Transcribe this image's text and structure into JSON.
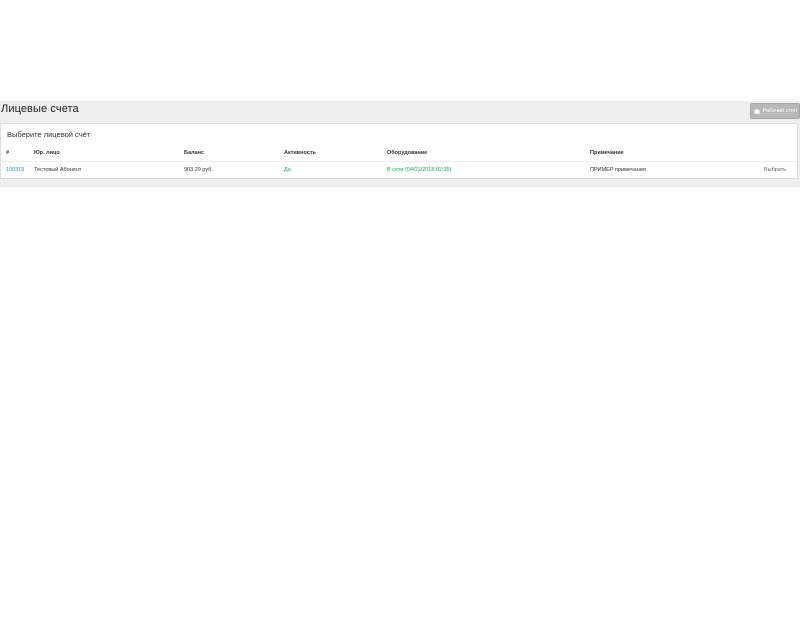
{
  "page": {
    "title": "Лицевые счета",
    "desk_button_label": "Рабочий стол",
    "desk_icon": "briefcase-icon"
  },
  "panel": {
    "heading": "Выберите лицевой счёт"
  },
  "table": {
    "headers": [
      "#",
      "Юр. лицо",
      "Баланс",
      "Активность",
      "Оборудование",
      "Примечание"
    ],
    "rows": [
      {
        "id": "100319",
        "entity": "Тестовый Абонент",
        "balance": "903.29 руб.",
        "activity": "Да",
        "equipment": "В сети (04/01/2018 02:35)",
        "note": "ПРИМЕР примечания",
        "action": "Выбрать"
      }
    ]
  },
  "colors": {
    "link": "#2a8fbd",
    "status_green": "#13a85a",
    "band": "#eeeeee",
    "button": "#b8b8b8"
  }
}
